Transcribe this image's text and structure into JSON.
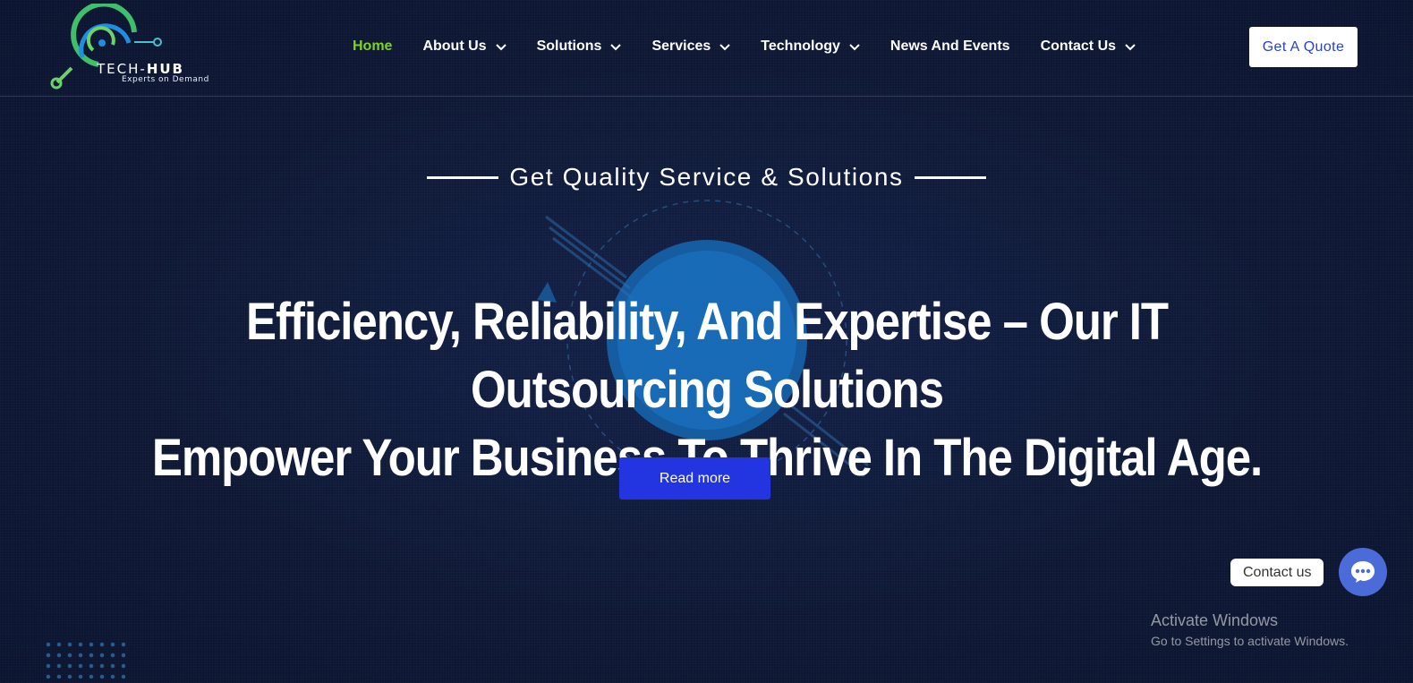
{
  "header": {
    "logo": {
      "name_light": "TECH-",
      "name_bold": "HUB",
      "tagline": "Experts on Demand"
    },
    "nav": [
      {
        "label": "Home",
        "active": true,
        "dropdown": false
      },
      {
        "label": "About Us",
        "active": false,
        "dropdown": true
      },
      {
        "label": "Solutions",
        "active": false,
        "dropdown": true
      },
      {
        "label": "Services",
        "active": false,
        "dropdown": true
      },
      {
        "label": "Technology",
        "active": false,
        "dropdown": true
      },
      {
        "label": "News And Events",
        "active": false,
        "dropdown": false
      },
      {
        "label": "Contact Us",
        "active": false,
        "dropdown": true
      }
    ],
    "quote_button": "Get A Quote"
  },
  "hero": {
    "tagline": "Get Quality Service & Solutions",
    "headline_line1": "Efficiency, Reliability, And Expertise – Our IT Outsourcing Solutions",
    "headline_line2": "Empower Your Business To Thrive In The Digital Age.",
    "read_more": "Read more"
  },
  "contact_widget": {
    "label": "Contact us"
  },
  "windows_watermark": {
    "title": "Activate Windows",
    "subtitle": "Go to Settings to activate Windows."
  },
  "colors": {
    "background": "#0f1a38",
    "nav_active": "#7ed321",
    "primary_button": "#2335e0",
    "quote_text": "#2941c7",
    "fab": "#4a6bd8"
  },
  "icons": [
    "chevron-down-icon",
    "chat-icon",
    "globe-graphic"
  ]
}
